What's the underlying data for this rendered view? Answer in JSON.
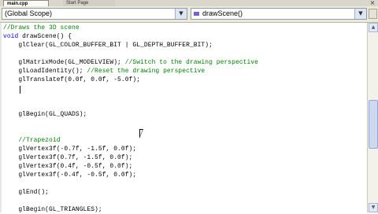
{
  "tabs": [
    {
      "label": "main.cpp",
      "active": true
    },
    {
      "label": "Start Page",
      "active": false
    }
  ],
  "nav": {
    "scope": "(Global Scope)",
    "function": "drawScene()"
  },
  "code": [
    [
      {
        "t": "cm",
        "s": "//Draws the 3D scene"
      }
    ],
    [
      {
        "t": "kw",
        "s": "void"
      },
      {
        "t": "tx",
        "s": " drawScene() {"
      }
    ],
    [
      {
        "t": "tx",
        "s": "    glClear(GL_COLOR_BUFFER_BIT | GL_DEPTH_BUFFER_BIT);"
      }
    ],
    [
      {
        "t": "tx",
        "s": ""
      }
    ],
    [
      {
        "t": "tx",
        "s": "    glMatrixMode(GL_MODELVIEW); "
      },
      {
        "t": "cm",
        "s": "//Switch to the drawing perspective"
      }
    ],
    [
      {
        "t": "tx",
        "s": "    glLoadIdentity(); "
      },
      {
        "t": "cm",
        "s": "//Reset the drawing perspective"
      }
    ],
    [
      {
        "t": "tx",
        "s": "    glTranslatef(0.0f, 0.0f, -5.0f);"
      }
    ],
    [
      {
        "t": "tx",
        "s": ""
      }
    ],
    [
      {
        "t": "tx",
        "s": ""
      }
    ],
    [
      {
        "t": "tx",
        "s": ""
      }
    ],
    [
      {
        "t": "tx",
        "s": "    glBegin(GL_QUADS);"
      }
    ],
    [
      {
        "t": "tx",
        "s": ""
      }
    ],
    [
      {
        "t": "tx",
        "s": ""
      }
    ],
    [
      {
        "t": "cm",
        "s": "    //Trapezoid"
      }
    ],
    [
      {
        "t": "tx",
        "s": "    glVertex3f(-0.7f, -1.5f, 0.0f);"
      }
    ],
    [
      {
        "t": "tx",
        "s": "    glVertex3f(0.7f, -1.5f, 0.0f);"
      }
    ],
    [
      {
        "t": "tx",
        "s": "    glVertex3f(0.4f, -0.5f, 0.0f);"
      }
    ],
    [
      {
        "t": "tx",
        "s": "    glVertex3f(-0.4f, -0.5f, 0.0f);"
      }
    ],
    [
      {
        "t": "tx",
        "s": ""
      }
    ],
    [
      {
        "t": "tx",
        "s": "    glEnd();"
      }
    ],
    [
      {
        "t": "tx",
        "s": ""
      }
    ],
    [
      {
        "t": "tx",
        "s": "    glBegin(GL_TRIANGLES);"
      }
    ]
  ],
  "icons": {
    "scope_arrow": "chevron-down-icon",
    "function_arrow": "chevron-down-icon",
    "function_icon": "method-icon",
    "close": "close-icon"
  },
  "colors": {
    "keyword": "#0000ff",
    "comment": "#008000",
    "text": "#000000"
  }
}
